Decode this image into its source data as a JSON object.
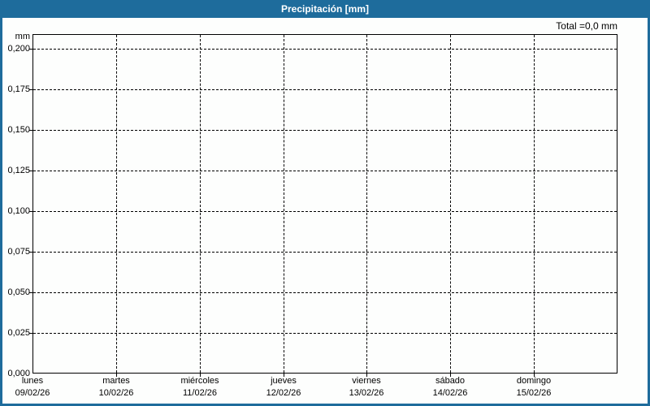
{
  "header": {
    "title": "Precipitación [mm]"
  },
  "colors": {
    "titlebar_blue": "#1e6c9c",
    "grid_line": "#000000",
    "label_text": "#000000",
    "title_text": "#ffffff",
    "background": "#fdfefd"
  },
  "chart_data": {
    "type": "line",
    "title": "Precipitación [mm]",
    "ylabel": "mm",
    "total_label": "Total =0,0 mm",
    "total_value_mm": 0.0,
    "grid": "dashed",
    "legend": "none",
    "ylim": [
      0,
      0.209
    ],
    "y_ticks": [
      {
        "value": 0.0,
        "label": "0,000"
      },
      {
        "value": 0.025,
        "label": "0,025"
      },
      {
        "value": 0.05,
        "label": "0,050"
      },
      {
        "value": 0.075,
        "label": "0,075"
      },
      {
        "value": 0.1,
        "label": "0,100"
      },
      {
        "value": 0.125,
        "label": "0,125"
      },
      {
        "value": 0.15,
        "label": "0,150"
      },
      {
        "value": 0.175,
        "label": "0,175"
      },
      {
        "value": 0.2,
        "label": "0,200"
      }
    ],
    "x_ticks": [
      {
        "day": "lunes",
        "date": "09/02/26"
      },
      {
        "day": "martes",
        "date": "10/02/26"
      },
      {
        "day": "miércoles",
        "date": "11/02/26"
      },
      {
        "day": "jueves",
        "date": "12/02/26"
      },
      {
        "day": "viernes",
        "date": "13/02/26"
      },
      {
        "day": "sábado",
        "date": "14/02/26"
      },
      {
        "day": "domingo",
        "date": "15/02/26"
      }
    ],
    "series": [
      {
        "name": "Precipitación",
        "values": [
          0,
          0,
          0,
          0,
          0,
          0,
          0
        ]
      }
    ]
  }
}
